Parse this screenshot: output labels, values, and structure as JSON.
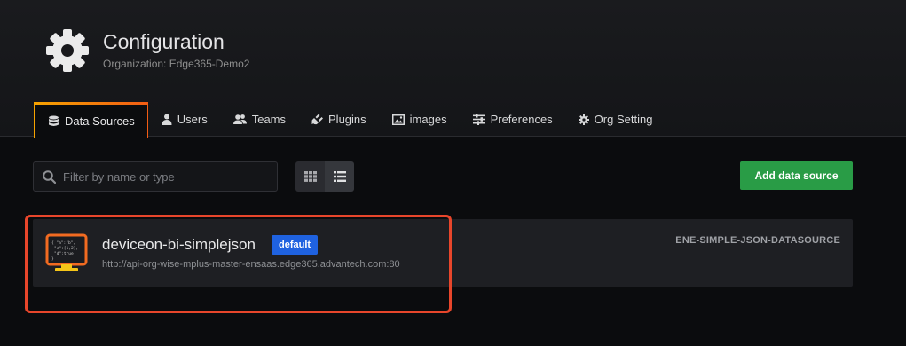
{
  "header": {
    "title": "Configuration",
    "subtitle": "Organization: Edge365-Demo2",
    "icon": "gear-icon"
  },
  "tabs": [
    {
      "label": "Data Sources",
      "icon": "database-icon",
      "active": true
    },
    {
      "label": "Users",
      "icon": "user-icon",
      "active": false
    },
    {
      "label": "Teams",
      "icon": "users-icon",
      "active": false
    },
    {
      "label": "Plugins",
      "icon": "plug-icon",
      "active": false
    },
    {
      "label": "images",
      "icon": "image-icon",
      "active": false
    },
    {
      "label": "Preferences",
      "icon": "sliders-icon",
      "active": false
    },
    {
      "label": "Org Setting",
      "icon": "cog-icon",
      "active": false
    }
  ],
  "toolbar": {
    "search_placeholder": "Filter by name or type",
    "search_value": "",
    "view_mode": "list",
    "add_label": "Add data source"
  },
  "datasources": [
    {
      "name": "deviceon-bi-simplejson",
      "badge": "default",
      "url": "http://api-org-wise-mplus-master-ensaas.edge365.advantech.com:80",
      "type": "ENE-SIMPLE-JSON-DATASOURCE",
      "highlighted": true
    }
  ],
  "colors": {
    "accent_orange": "#f6a300",
    "add_button": "#299c46",
    "badge": "#1f62e0",
    "highlight": "#e8462b"
  }
}
